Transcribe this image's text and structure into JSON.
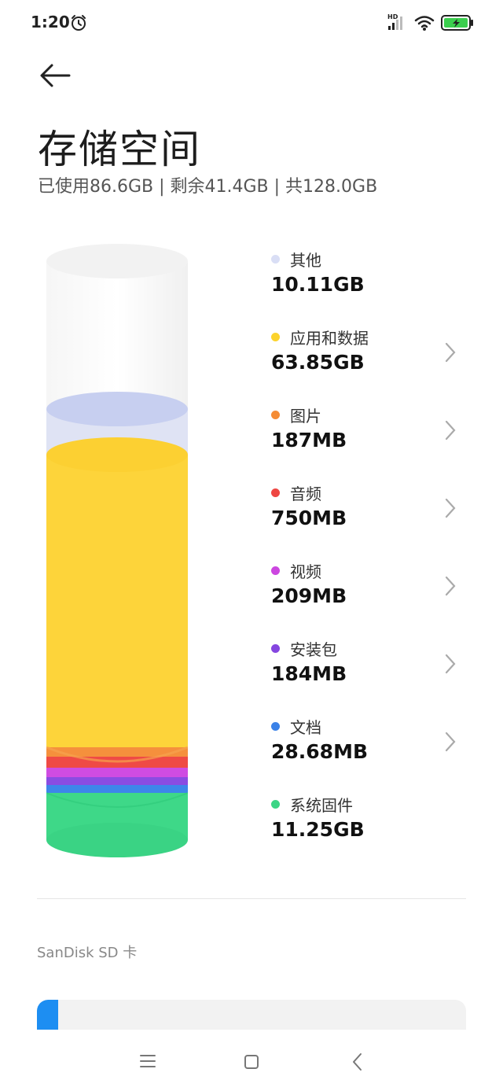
{
  "status": {
    "time": "1:20",
    "signal_badge": "HD",
    "icons": [
      "alarm-icon",
      "signal-icon",
      "wifi-icon",
      "battery-charging-icon"
    ]
  },
  "header": {
    "back_icon": "arrow-left-icon",
    "title": "存储空间",
    "summary": "已使用86.6GB | 剩余41.4GB | 共128.0GB"
  },
  "categories": [
    {
      "key": "other",
      "label": "其他",
      "size": "10.11GB",
      "color": "#d9def5",
      "has_chevron": false
    },
    {
      "key": "apps",
      "label": "应用和数据",
      "size": "63.85GB",
      "color": "#fcd32d",
      "has_chevron": true
    },
    {
      "key": "images",
      "label": "图片",
      "size": "187MB",
      "color": "#f58c35",
      "has_chevron": true
    },
    {
      "key": "audio",
      "label": "音频",
      "size": "750MB",
      "color": "#ee4642",
      "has_chevron": true
    },
    {
      "key": "video",
      "label": "视频",
      "size": "209MB",
      "color": "#cc46e0",
      "has_chevron": true
    },
    {
      "key": "apk",
      "label": "安装包",
      "size": "184MB",
      "color": "#8546e0",
      "has_chevron": true
    },
    {
      "key": "docs",
      "label": "文档",
      "size": "28.68MB",
      "color": "#3b82e8",
      "has_chevron": true
    },
    {
      "key": "system",
      "label": "系统固件",
      "size": "11.25GB",
      "color": "#3bd585",
      "has_chevron": false
    }
  ],
  "sd_card": {
    "label": "SanDisk SD 卡",
    "used_fraction": 0.05,
    "accent": "#1d8ef2"
  },
  "nav": {
    "icons": [
      "menu-icon",
      "home-icon",
      "back-icon"
    ]
  }
}
